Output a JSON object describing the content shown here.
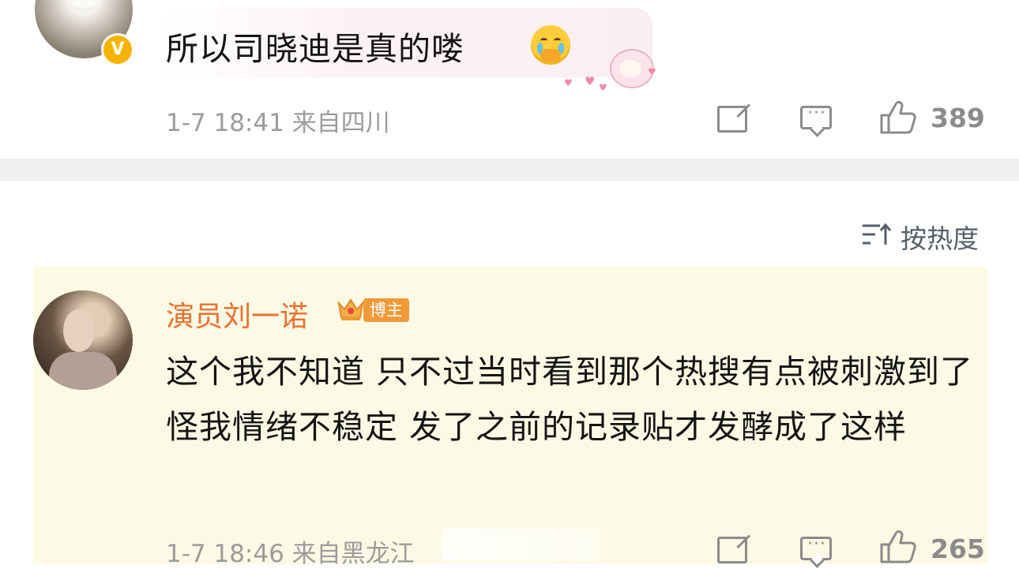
{
  "comments": [
    {
      "user": "",
      "verified_badge": "V",
      "text": "所以司晓迪是真的喽",
      "emoji_icon": "crying-face-emoji",
      "sticker": "sheep-sticker",
      "meta": "1-7 18:41 来自四川",
      "likes": "389"
    },
    {
      "user": "演员刘一诺",
      "role_badge": "博主",
      "text": "这个我不知道 只不过当时看到那个热搜有点被刺激到了 怪我情绪不稳定 发了之前的记录贴才发酵成了这样",
      "meta": "1-7 18:46 来自黑龙江",
      "likes": "265"
    }
  ],
  "sort": {
    "label": "按热度",
    "icon": "sort-icon"
  },
  "colors": {
    "name": "#ea7130",
    "meta": "#9c9c9c",
    "highlight_bg": "#fcfae4",
    "divider": "#f0f0f0",
    "badge": "#f09a37",
    "verified": "#f6b400"
  }
}
